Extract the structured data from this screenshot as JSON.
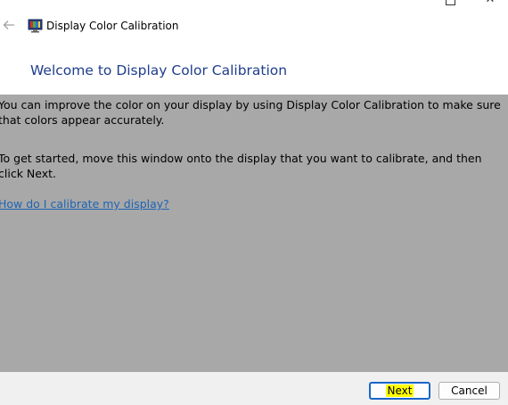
{
  "window": {
    "title": "Display Color Calibration",
    "controls": {
      "maximize_icon": "maximize-icon",
      "close_icon": "close-icon"
    }
  },
  "header": {
    "back_icon": "back-arrow-icon",
    "app_icon": "monitor-calibration-icon",
    "page_title": "Welcome to Display Color Calibration"
  },
  "content": {
    "paragraph1": "You can improve the color on your display by using Display Color Calibration to make sure that colors appear accurately.",
    "paragraph2": "To get started, move this window onto the display that you want to calibrate, and then click Next.",
    "help_link": "How do I calibrate my display?"
  },
  "footer": {
    "next_label": "Next",
    "cancel_label": "Cancel"
  },
  "colors": {
    "title_blue": "#1f3e8c",
    "link_blue": "#1e64b4",
    "content_bg": "#a8a8a8",
    "footer_bg": "#f0f0f0",
    "highlight": "#ffff00"
  }
}
